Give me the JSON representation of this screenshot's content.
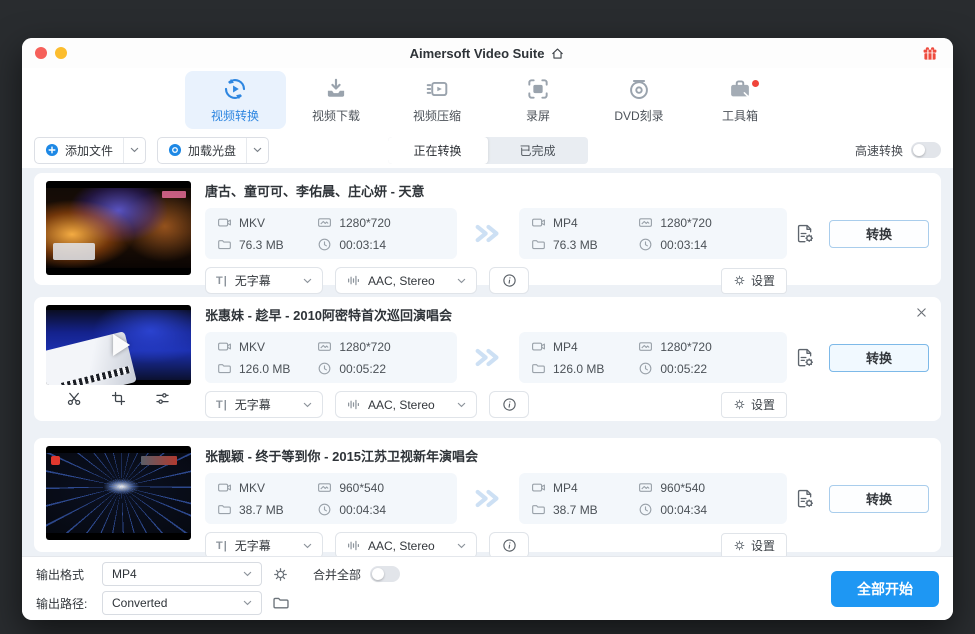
{
  "colors": {
    "accent": "#1d88e5",
    "start_button": "#1e97f3",
    "notification_dot": "#f0443a",
    "active_tab_bg": "#e9f2fd"
  },
  "titlebar": {
    "title": "Aimersoft Video Suite"
  },
  "nav": {
    "tabs": [
      {
        "label": "视频转换"
      },
      {
        "label": "视频下载"
      },
      {
        "label": "视频压缩"
      },
      {
        "label": "录屏"
      },
      {
        "label": "DVD刻录"
      },
      {
        "label": "工具箱"
      }
    ]
  },
  "toolbar": {
    "add_files": "添加文件",
    "load_disc": "加载光盘",
    "converting_tab": "正在转换",
    "completed_tab": "已完成",
    "high_speed": "高速转换"
  },
  "labels": {
    "convert": "转换",
    "settings": "设置",
    "subtitle_glyph": "T|"
  },
  "rows": [
    {
      "title": "唐古、童可可、李佑晨、庄心妍 - 天意",
      "source": {
        "format": "MKV",
        "resolution": "1280*720",
        "size": "76.3 MB",
        "duration": "00:03:14"
      },
      "target": {
        "format": "MP4",
        "resolution": "1280*720",
        "size": "76.3 MB",
        "duration": "00:03:14"
      },
      "subtitle": "无字幕",
      "audio": "AAC, Stereo"
    },
    {
      "title": "张惠妹 - 趁早 - 2010阿密特首次巡回演唱会",
      "source": {
        "format": "MKV",
        "resolution": "1280*720",
        "size": "126.0 MB",
        "duration": "00:05:22"
      },
      "target": {
        "format": "MP4",
        "resolution": "1280*720",
        "size": "126.0 MB",
        "duration": "00:05:22"
      },
      "subtitle": "无字幕",
      "audio": "AAC, Stereo"
    },
    {
      "title": "张靓颖 - 终于等到你 - 2015江苏卫视新年演唱会",
      "source": {
        "format": "MKV",
        "resolution": "960*540",
        "size": "38.7 MB",
        "duration": "00:04:34"
      },
      "target": {
        "format": "MP4",
        "resolution": "960*540",
        "size": "38.7 MB",
        "duration": "00:04:34"
      },
      "subtitle": "无字幕",
      "audio": "AAC, Stereo"
    }
  ],
  "footer": {
    "output_format_label": "输出格式",
    "output_format_value": "MP4",
    "merge_all_label": "合并全部",
    "output_path_label": "输出路径:",
    "output_path_value": "Converted",
    "start_all": "全部开始"
  }
}
